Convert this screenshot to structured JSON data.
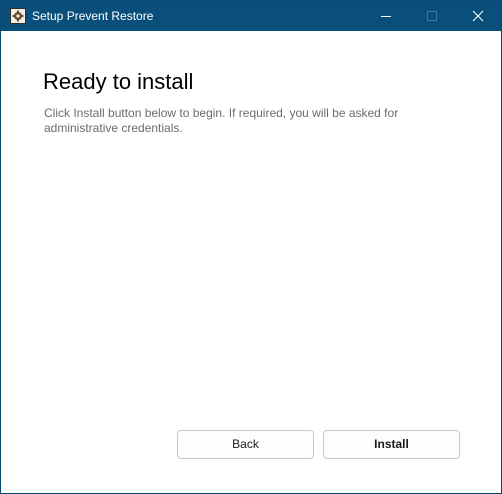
{
  "window": {
    "title": "Setup Prevent Restore",
    "icon": "setup-gear-icon",
    "controls": {
      "minimize_icon": "minimize-icon",
      "maximize_icon": "maximize-icon",
      "close_icon": "close-icon"
    },
    "colors": {
      "titlebar": "#0a4f7c",
      "border": "#0a4a72"
    }
  },
  "page": {
    "heading": "Ready to install",
    "description": "Click Install button below to begin. If required, you will be asked for administrative credentials."
  },
  "buttons": {
    "back_label": "Back",
    "install_label": "Install"
  }
}
